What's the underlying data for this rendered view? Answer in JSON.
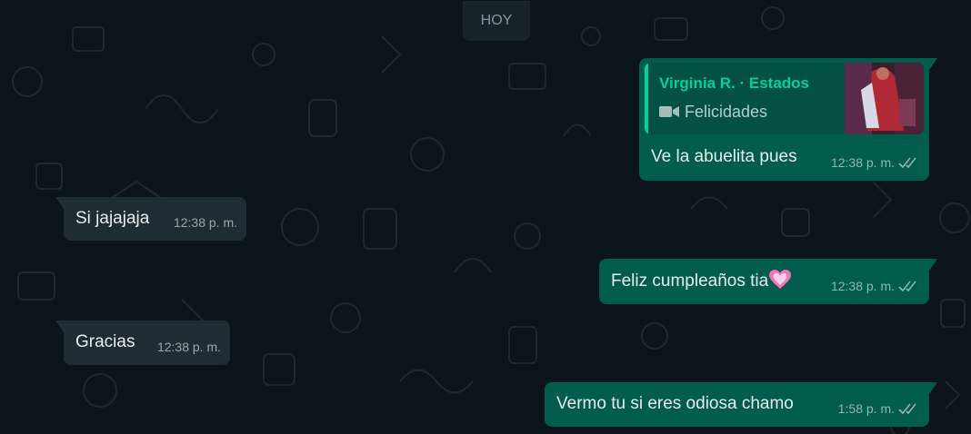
{
  "date_divider": "HOY",
  "messages": [
    {
      "direction": "out",
      "quote": {
        "author": "Virginia R. · Estados",
        "media_icon": "video-camera-icon",
        "caption": "Felicidades"
      },
      "text": "Ve la abuelita pues",
      "time": "12:38 p. m.",
      "status": "read"
    },
    {
      "direction": "in",
      "text": "Si jajajaja",
      "time": "12:38 p. m."
    },
    {
      "direction": "out",
      "text": "Feliz cumpleaños tia",
      "emoji": "pink-heart-icon",
      "time": "12:38 p. m.",
      "status": "read"
    },
    {
      "direction": "in",
      "text": "Gracias",
      "time": "12:38 p. m."
    },
    {
      "direction": "out",
      "text": "Vermo tu si eres odiosa chamo",
      "time": "1:58 p. m.",
      "status": "read"
    }
  ],
  "colors": {
    "background": "#0b141a",
    "incoming_bubble": "#202c33",
    "outgoing_bubble": "#005c4b",
    "quote_accent": "#06cf9c"
  }
}
